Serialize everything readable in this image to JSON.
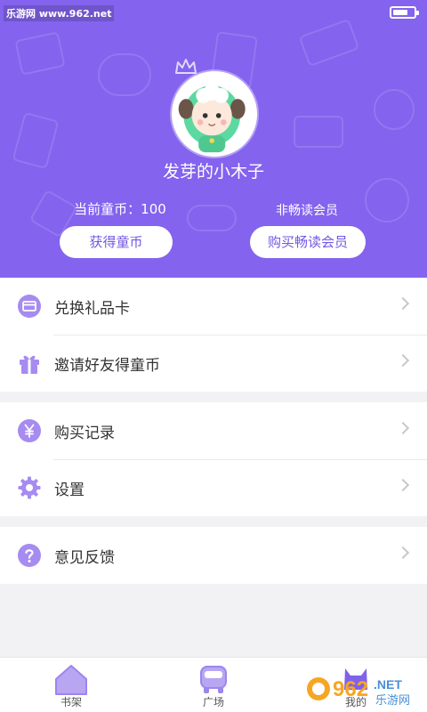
{
  "status_bar": {
    "watermark": "乐游网 www.962.net",
    "battery_level": 0.75
  },
  "profile": {
    "username": "发芽的小木子",
    "coins_label": "当前童币：100",
    "membership_status": "非畅读会员",
    "earn_button": "获得童币",
    "buy_button": "购买畅读会员"
  },
  "menu_groups": [
    [
      {
        "label": "兑换礼品卡",
        "icon": "card-icon"
      },
      {
        "label": "邀请好友得童币",
        "icon": "gift-icon"
      }
    ],
    [
      {
        "label": "购买记录",
        "icon": "yen-icon"
      },
      {
        "label": "设置",
        "icon": "gear-icon"
      }
    ],
    [
      {
        "label": "意见反馈",
        "icon": "question-icon"
      }
    ]
  ],
  "tabbar": {
    "tabs": [
      {
        "label": "书架",
        "icon": "house-icon"
      },
      {
        "label": "广场",
        "icon": "car-icon"
      },
      {
        "label": "我的",
        "icon": "cat-icon"
      }
    ]
  },
  "watermark_bottom": {
    "number": "962",
    "suffix": ".NET",
    "text": "乐游网"
  },
  "colors": {
    "accent": "#8463ee",
    "icon": "#a68bf0",
    "button_text": "#7357e3",
    "background": "#f2f2f4"
  }
}
